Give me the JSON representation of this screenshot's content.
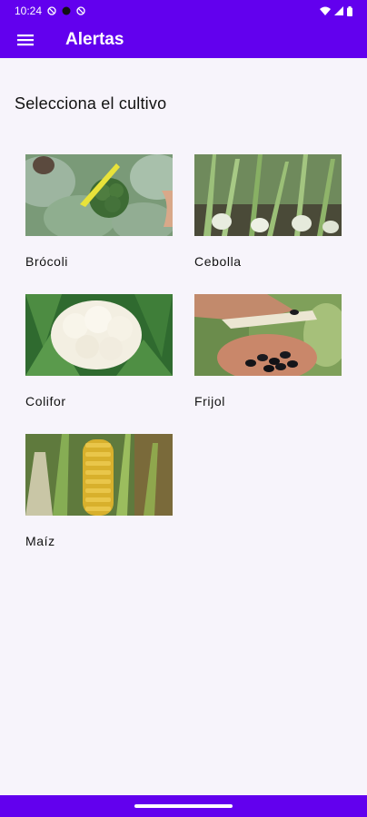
{
  "status_bar": {
    "time": "10:24",
    "colors": {
      "bar": "#6200ee"
    }
  },
  "app_bar": {
    "title": "Alertas",
    "menu_icon": "hamburger-menu-icon"
  },
  "main": {
    "heading": "Selecciona el cultivo",
    "crops": [
      {
        "label": "Brócoli",
        "image": "broccoli-photo"
      },
      {
        "label": "Cebolla",
        "image": "onion-photo"
      },
      {
        "label": "Colifor",
        "image": "cauliflower-photo"
      },
      {
        "label": "Frijol",
        "image": "beans-photo"
      },
      {
        "label": "Maíz",
        "image": "corn-photo"
      }
    ]
  },
  "colors": {
    "primary": "#6200ee",
    "background": "#f7f4fb",
    "text": "#111111"
  }
}
